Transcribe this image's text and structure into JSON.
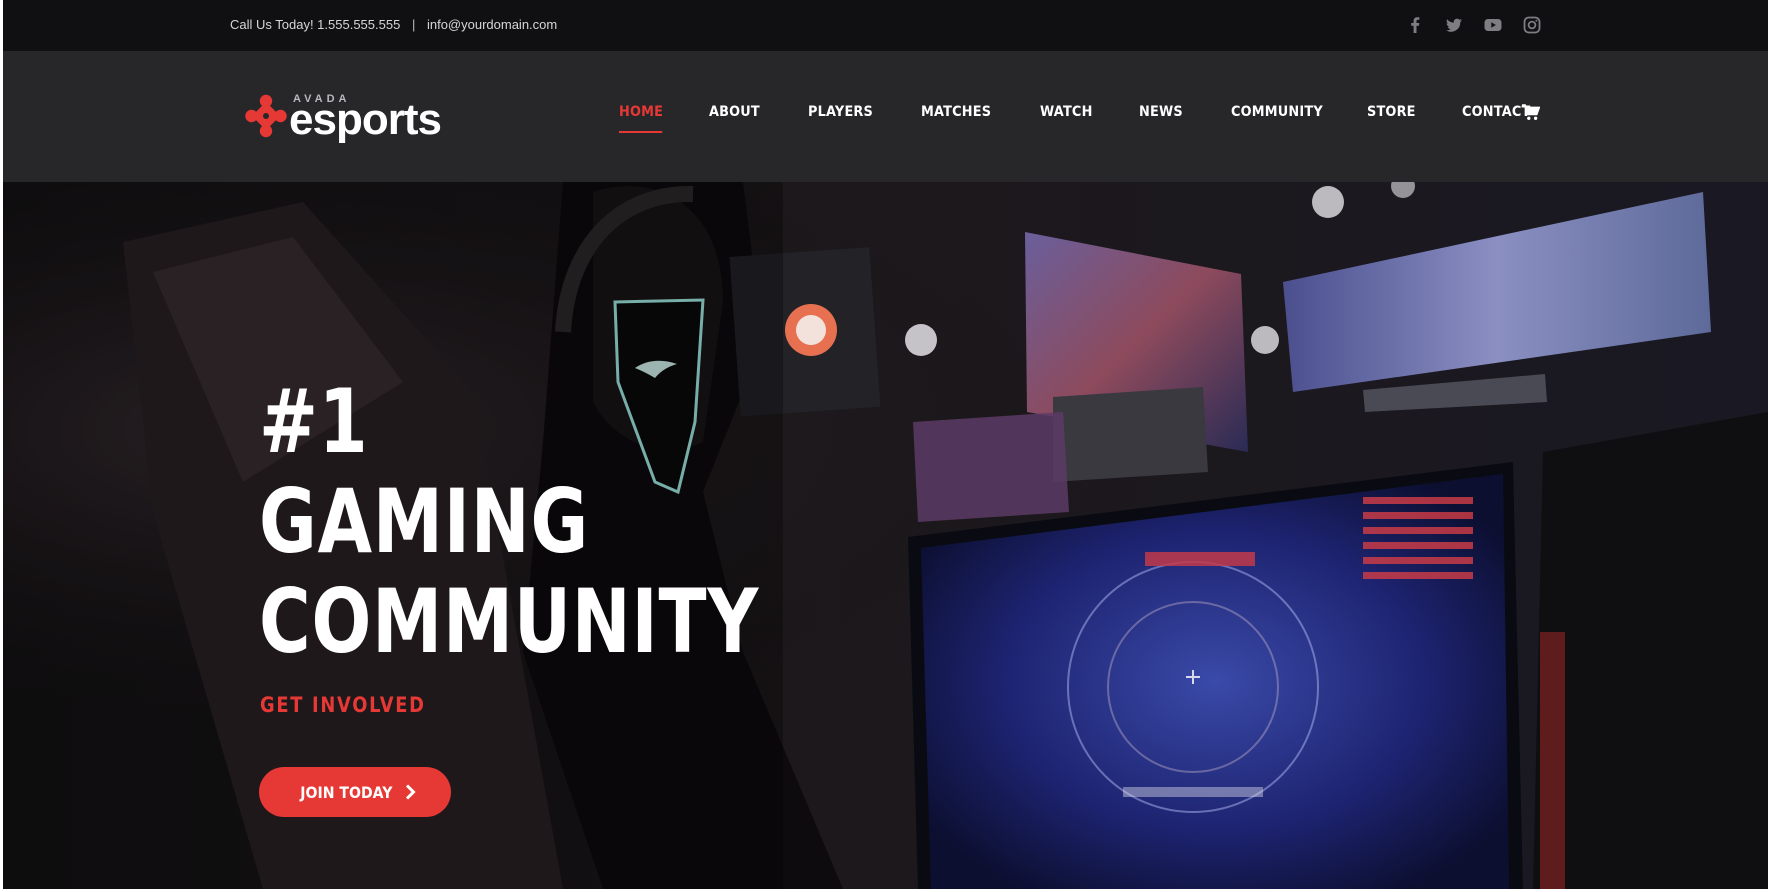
{
  "topbar": {
    "call_text": "Call Us Today! 1.555.555.555",
    "separator": "|",
    "email": "info@yourdomain.com",
    "social_icons": [
      "facebook-icon",
      "twitter-icon",
      "youtube-icon",
      "instagram-icon"
    ]
  },
  "logo": {
    "small": "AVADA",
    "main": "esports"
  },
  "nav": {
    "items": [
      "HOME",
      "ABOUT",
      "PLAYERS",
      "MATCHES",
      "WATCH",
      "NEWS",
      "COMMUNITY",
      "STORE",
      "CONTACT"
    ],
    "active_index": 0,
    "cart_icon": "cart-icon"
  },
  "hero": {
    "line1": "#1",
    "line2": "GAMING",
    "line3": "COMMUNITY",
    "tagline": "GET INVOLVED",
    "cta_label": "JOIN TODAY",
    "cta_icon": "chevron-right-icon"
  },
  "colors": {
    "accent": "#e63935",
    "topbar_bg": "#101012",
    "header_bg": "#27272a",
    "text": "#ffffff"
  }
}
